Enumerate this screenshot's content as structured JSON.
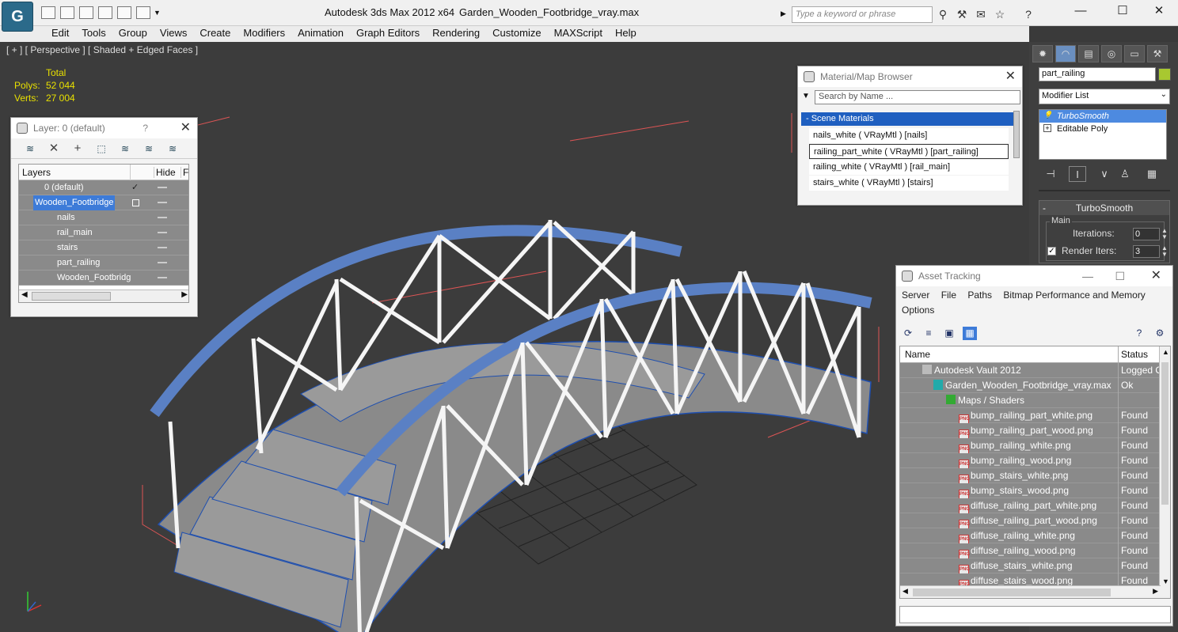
{
  "app": {
    "logo_glyph": "G",
    "title": "Autodesk 3ds Max  2012 x64",
    "file": "Garden_Wooden_Footbridge_vray.max",
    "search_placeholder": "Type a keyword or phrase",
    "minimize": "—",
    "maximize": "☐",
    "close": "✕"
  },
  "menu": [
    "Edit",
    "Tools",
    "Group",
    "Views",
    "Create",
    "Modifiers",
    "Animation",
    "Graph Editors",
    "Rendering",
    "Customize",
    "MAXScript",
    "Help"
  ],
  "viewport": {
    "label": "[ + ] [ Perspective ] [ Shaded + Edged Faces ]",
    "stats": {
      "header": "Total",
      "polys_label": "Polys:",
      "polys": "52 044",
      "verts_label": "Verts:",
      "verts": "27 004"
    }
  },
  "layer_panel": {
    "title": "Layer: 0 (default)",
    "help": "?",
    "close": "✕",
    "col_layers": "Layers",
    "col_hide": "Hide",
    "col_freeze": "Fr",
    "rows": [
      {
        "name": "0 (default)"
      },
      {
        "name": "Wooden_Footbridge"
      },
      {
        "name": "nails"
      },
      {
        "name": "rail_main"
      },
      {
        "name": "stairs"
      },
      {
        "name": "part_railing"
      },
      {
        "name": "Wooden_Footbridg"
      }
    ]
  },
  "material_browser": {
    "title": "Material/Map Browser",
    "close": "✕",
    "search_placeholder": "Search by Name ...",
    "group": "- Scene Materials",
    "items": [
      "nails_white  ( VRayMtl ) [nails]",
      "railing_part_white  ( VRayMtl ) [part_railing]",
      "railing_white  ( VRayMtl ) [rail_main]",
      "stairs_white  ( VRayMtl ) [stairs]"
    ]
  },
  "command_panel": {
    "object_name": "part_railing",
    "object_color": "#a8c830",
    "modifier_list": "Modifier List",
    "stack": [
      "TurboSmooth",
      "Editable Poly"
    ],
    "rollout_title": "TurboSmooth",
    "group_main": "Main",
    "iterations_label": "Iterations:",
    "iterations": "0",
    "render_iters_label": "Render Iters:",
    "render_iters": "3"
  },
  "asset_tracking": {
    "title": "Asset Tracking",
    "menu": [
      "Server",
      "File",
      "Paths",
      "Bitmap Performance and Memory",
      "Options"
    ],
    "col_name": "Name",
    "col_status": "Status",
    "rows": [
      {
        "name": "Autodesk Vault 2012",
        "status": "Logged O",
        "indent": 1
      },
      {
        "name": "Garden_Wooden_Footbridge_vray.max",
        "status": "Ok",
        "indent": 2
      },
      {
        "name": "Maps / Shaders",
        "status": "",
        "indent": 3
      },
      {
        "name": "bump_railing_part_white.png",
        "status": "Found",
        "indent": 4
      },
      {
        "name": "bump_railing_part_wood.png",
        "status": "Found",
        "indent": 4
      },
      {
        "name": "bump_railing_white.png",
        "status": "Found",
        "indent": 4
      },
      {
        "name": "bump_railing_wood.png",
        "status": "Found",
        "indent": 4
      },
      {
        "name": "bump_stairs_white.png",
        "status": "Found",
        "indent": 4
      },
      {
        "name": "bump_stairs_wood.png",
        "status": "Found",
        "indent": 4
      },
      {
        "name": "diffuse_railing_part_white.png",
        "status": "Found",
        "indent": 4
      },
      {
        "name": "diffuse_railing_part_wood.png",
        "status": "Found",
        "indent": 4
      },
      {
        "name": "diffuse_railing_white.png",
        "status": "Found",
        "indent": 4
      },
      {
        "name": "diffuse_railing_wood.png",
        "status": "Found",
        "indent": 4
      },
      {
        "name": "diffuse_stairs_white.png",
        "status": "Found",
        "indent": 4
      },
      {
        "name": "diffuse_stairs_wood.png",
        "status": "Found",
        "indent": 4
      }
    ]
  }
}
